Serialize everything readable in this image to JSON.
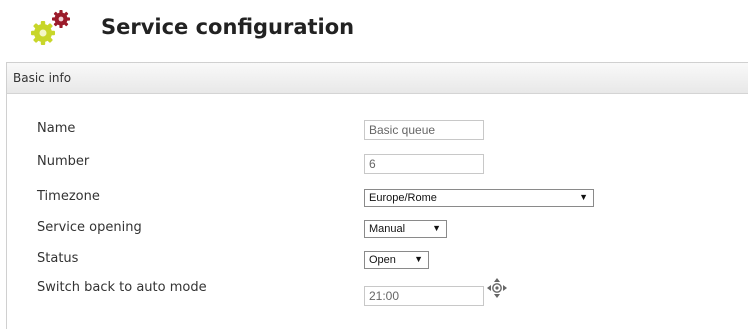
{
  "header": {
    "title": "Service configuration",
    "icon": "gears-icon"
  },
  "panel": {
    "title": "Basic info"
  },
  "form": {
    "name": {
      "label": "Name",
      "value": "Basic queue"
    },
    "number": {
      "label": "Number",
      "value": "6"
    },
    "timezone": {
      "label": "Timezone",
      "value": "Europe/Rome"
    },
    "service_opening": {
      "label": "Service opening",
      "value": "Manual"
    },
    "status": {
      "label": "Status",
      "value": "Open"
    },
    "switch_back": {
      "label": "Switch back to auto mode",
      "value": "21:00"
    }
  },
  "colors": {
    "gear_yellow": "#c8d62a",
    "gear_red": "#9b1b2a"
  }
}
